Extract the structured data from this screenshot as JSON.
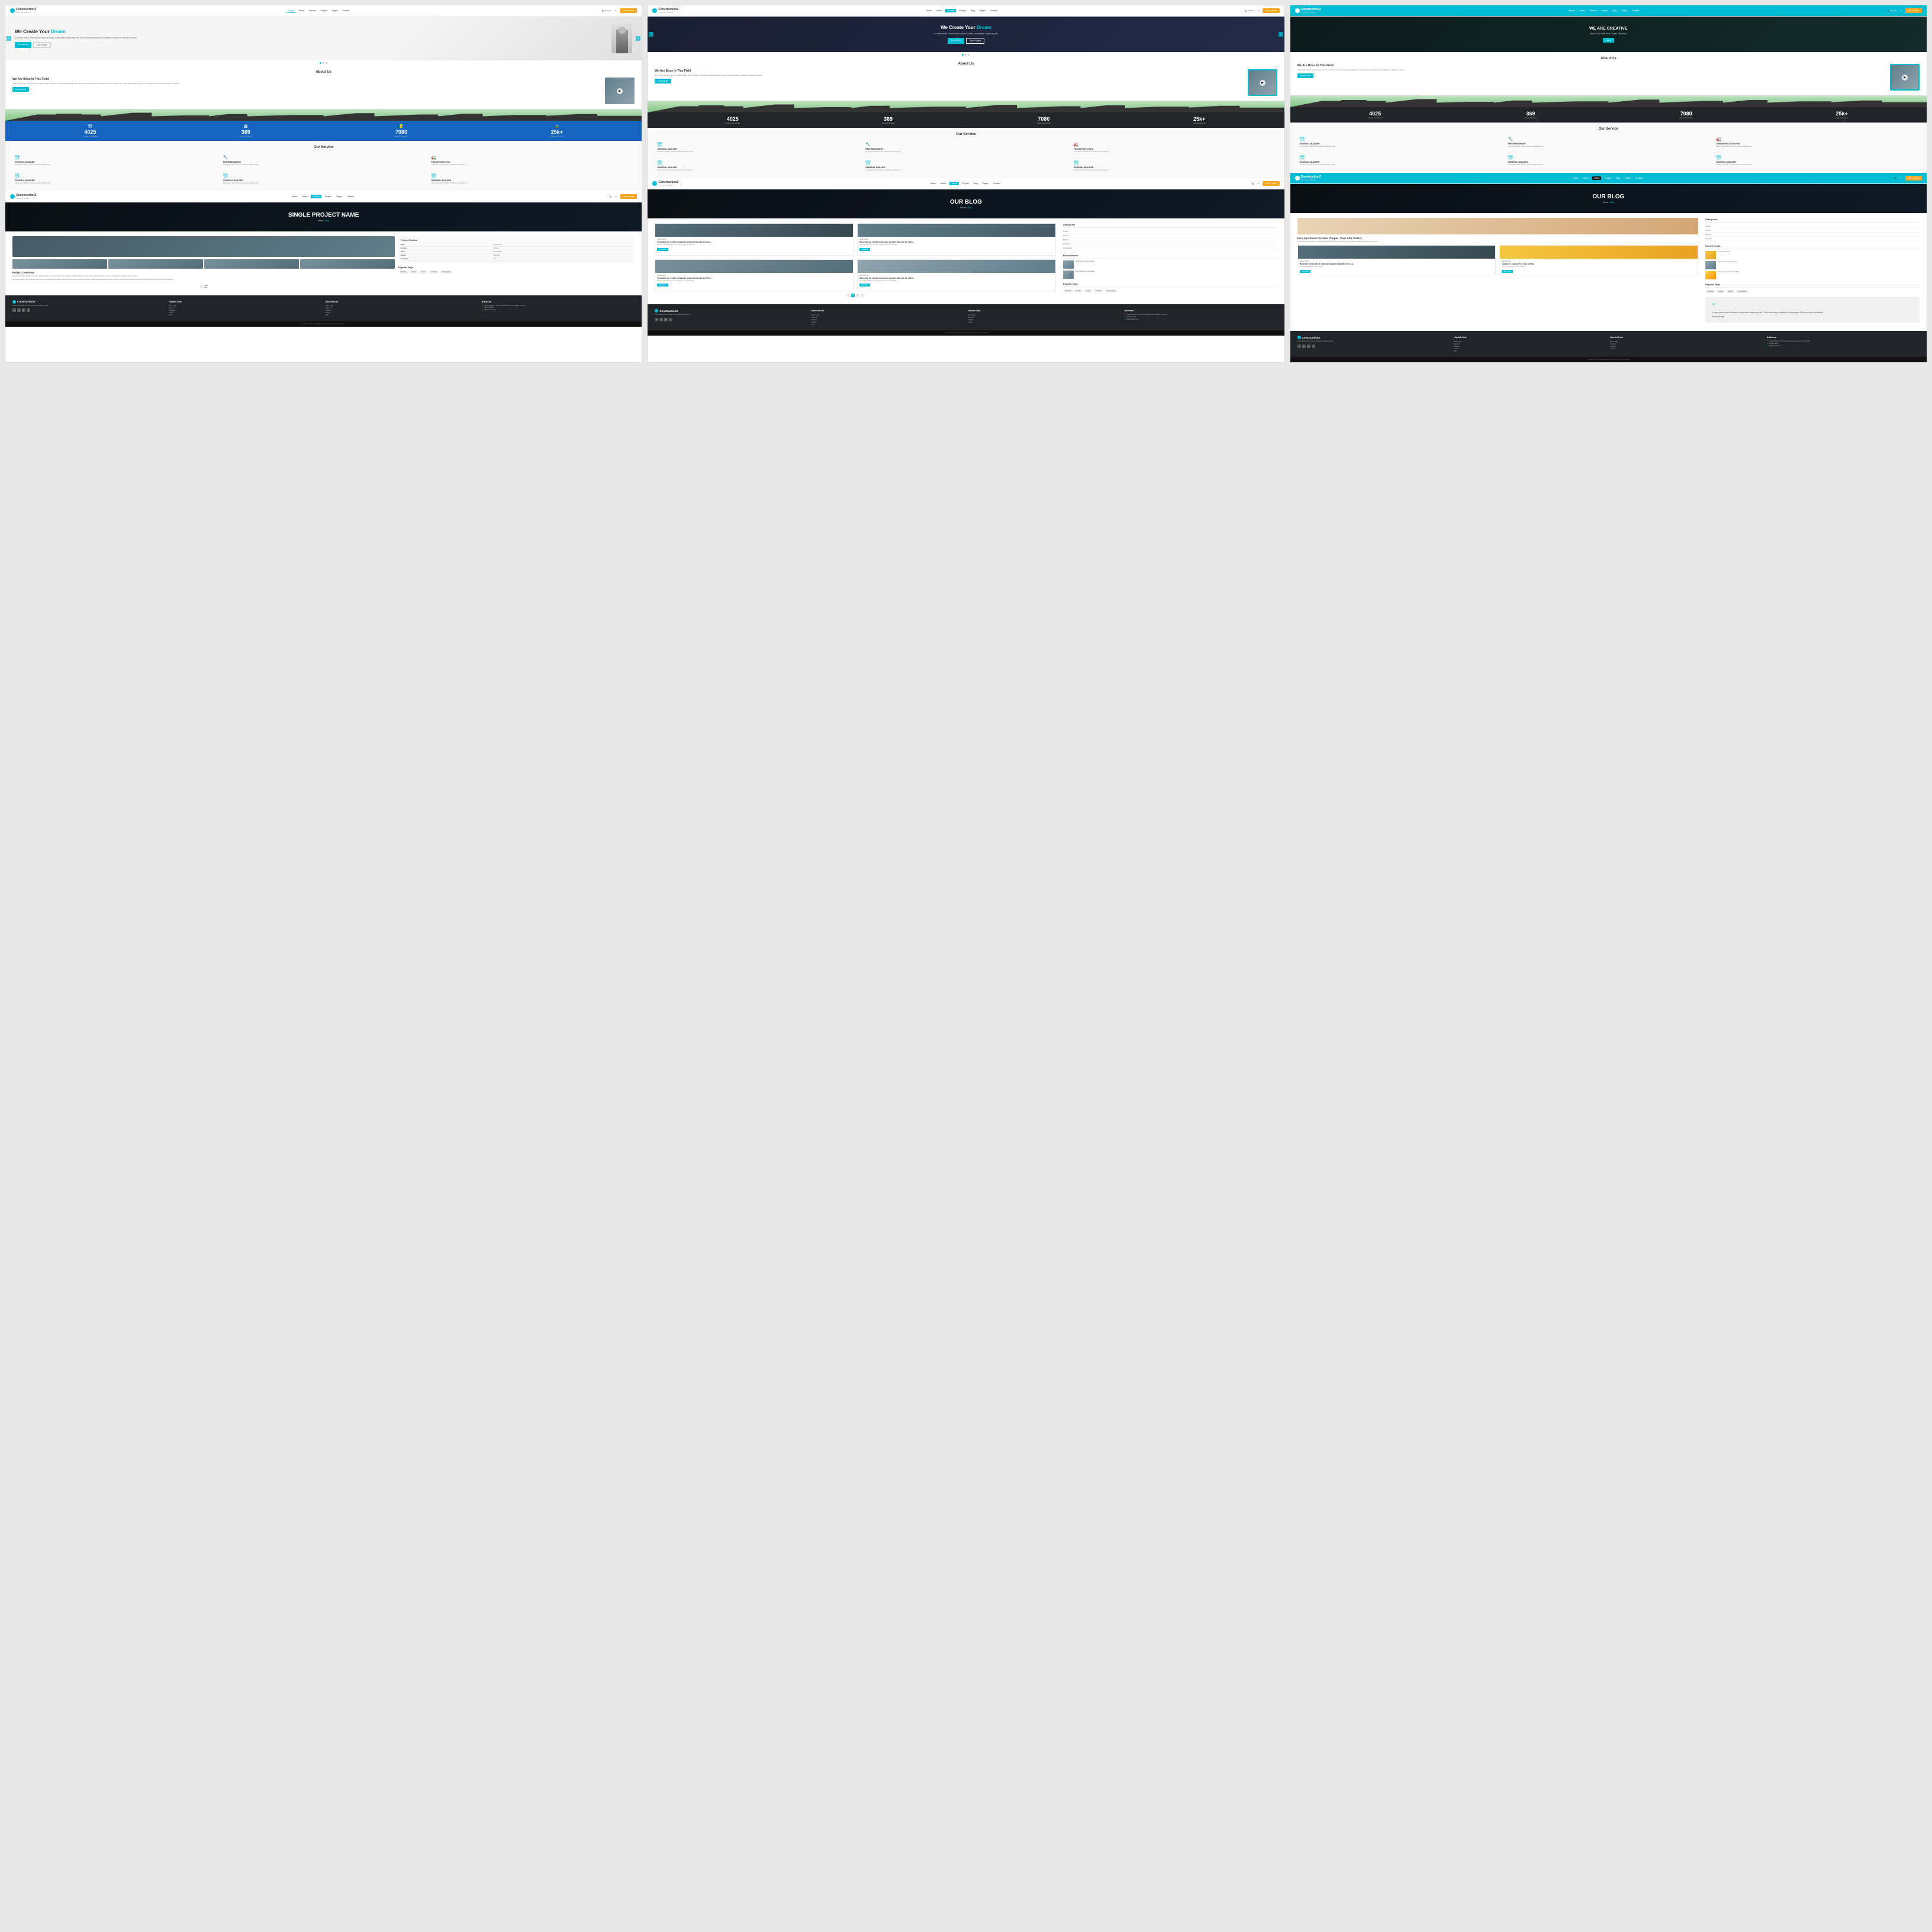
{
  "cards": [
    {
      "id": "card-1",
      "variant": "light-hero",
      "header": {
        "logo": "ConstructionZ",
        "tagline": "The King of Design",
        "nav": [
          "Home",
          "About",
          "Service",
          "Project",
          "Pages",
          "Contact"
        ],
        "active_nav": "Home",
        "hotline": "Hotline",
        "hotline_num": "444-444",
        "email": "Search",
        "cta": "Get a quote"
      },
      "hero": {
        "title": "We Create Your",
        "title_accent": "Dream",
        "subtitle": "our team amet Lorem ipsum dolor sit amet, consectetur adipiscing elit, sed do eiusmod tempor incididunt ut labore et dolore et labore.",
        "btn1": "Our Service",
        "btn2": "Our Project"
      },
      "about": {
        "section_title": "About Us",
        "sub_title": "We Are Boss In This Field",
        "body": "There was simply a dummy Lorem ipsum dolor sit amet, consectetur adipiscing elit, sed do eiusmod tempor incididunt ut labore et dolore et. There was simply a dummy Lorem ipsum dolor sit amet labore et dolore.",
        "btn": "Know More"
      },
      "stats": [
        {
          "num": "4025",
          "label": "Project Completed",
          "icon": "🏗"
        },
        {
          "num": "369",
          "label": "Running Project",
          "icon": "🏛"
        },
        {
          "num": "7080",
          "label": "Resource Person",
          "icon": "👷"
        },
        {
          "num": "25k+",
          "label": "Total Equipment",
          "icon": "🚜"
        }
      ],
      "stats_variant": "blue",
      "services": {
        "title": "Our Service",
        "items": [
          {
            "title": "GENERAL BUILDER",
            "desc": "Lorem ipsum dolor sit amet consectetur adipiscing elit sed do eiusmod."
          },
          {
            "title": "REFURBISHMENT",
            "desc": "Lorem ipsum dolor sit amet consectetur adipiscing elit sed do eiusmod."
          },
          {
            "title": "TRANSPORTATION",
            "desc": "Lorem ipsum dolor sit amet consectetur adipiscing elit sed do eiusmod."
          },
          {
            "title": "GENERAL BUILDER",
            "desc": "Lorem ipsum dolor sit amet consectetur adipiscing elit sed do eiusmod."
          },
          {
            "title": "GENERAL BUILDER",
            "desc": "Lorem ipsum dolor sit amet consectetur adipiscing elit sed do eiusmod."
          },
          {
            "title": "GENERAL BUILDER",
            "desc": "Lorem ipsum dolor sit amet consectetur adipiscing elit sed do eiusmod."
          }
        ]
      }
    },
    {
      "id": "card-2",
      "variant": "dark-hero",
      "header": {
        "logo": "ConstructionZ",
        "tagline": "The King of Design",
        "nav": [
          "Home",
          "About",
          "Service",
          "Project",
          "Blog",
          "Pages",
          "Contact"
        ],
        "active_nav": "Service",
        "hotline": "Hotline",
        "hotline_num": "444-444",
        "email": "Email",
        "cta": "Get a quote"
      },
      "hero": {
        "title": "We Create Your",
        "title_accent": "Dream",
        "subtitle": "our team amet Lorem ipsum dolor sit amet, consectetur adipiscing elit, sed do eiusmod tempor incididunt ut labore et dolore.",
        "btn1": "Our Service",
        "btn2": "Start Project"
      },
      "about": {
        "section_title": "About Us",
        "sub_title": "We Are Boss In This Field",
        "body": "There was simply a dummy Lorem ipsum dolor sit amet, consectetur adipiscing elit, sed do eiusmod tempor incididunt ut labore et dolore et. There was simply a dummy Lorem ipsum.",
        "btn": "Know More"
      },
      "stats": [
        {
          "num": "4025",
          "label": "Project Completed",
          "icon": "🏗"
        },
        {
          "num": "369",
          "label": "Running Project",
          "icon": "🏛"
        },
        {
          "num": "7080",
          "label": "Resource Person",
          "icon": "👷"
        },
        {
          "num": "25k+",
          "label": "Total Equipment",
          "icon": "🚜"
        }
      ],
      "stats_variant": "dark",
      "services": {
        "title": "Our Service",
        "items": [
          {
            "title": "GENERAL BUILDER",
            "desc": "Lorem ipsum dolor sit amet consectetur adipiscing elit sed do eiusmod."
          },
          {
            "title": "REFURBISHMENT",
            "desc": "Lorem ipsum dolor sit amet consectetur adipiscing elit sed do eiusmod."
          },
          {
            "title": "TRANSPORTATION",
            "desc": "Lorem ipsum dolor sit amet consectetur adipiscing elit sed do eiusmod."
          },
          {
            "title": "GENERAL BUILDER",
            "desc": "Lorem ipsum dolor sit amet consectetur adipiscing elit sed do eiusmod."
          },
          {
            "title": "GENERAL BUILDER",
            "desc": "Lorem ipsum dolor sit amet consectetur adipiscing elit sed do eiusmod."
          },
          {
            "title": "GENERAL BUILDER",
            "desc": "Lorem ipsum dolor sit amet consectetur adipiscing elit sed do eiusmod."
          }
        ]
      }
    },
    {
      "id": "card-3",
      "variant": "teal-hero",
      "header": {
        "logo": "ConstructionZ",
        "tagline": "The King of Design",
        "nav": [
          "Home",
          "About",
          "Service",
          "Project",
          "Blog",
          "Pages",
          "Contact"
        ],
        "active_nav": "Active",
        "hotline": "Hotline",
        "hotline_num": "444-444",
        "email": "Email",
        "cta": "Get a quote"
      },
      "hero": {
        "title": "WE ARE CREATIVE",
        "subtitle": "Help Us To Build Your Dream Tomorrow",
        "btn1": "Learn"
      },
      "about": {
        "section_title": "About Us",
        "sub_title": "We Are Boss In This Field",
        "body": "There was simply a dummy Lorem ipsum dolor sit amet, consectetur adipiscing elit, sed do eiusmod tempor incididunt ut labore et dolore. There was simply a dummy Lorem ipsum.",
        "btn": "Know More"
      },
      "stats": [
        {
          "num": "4025",
          "label": "Project Completed",
          "icon": "🏗"
        },
        {
          "num": "369",
          "label": "Running Project",
          "icon": "🏛"
        },
        {
          "num": "7080",
          "label": "Resource Person",
          "icon": "👷"
        },
        {
          "num": "25k+",
          "label": "Total Equipment",
          "icon": "🚜"
        }
      ],
      "stats_variant": "dark",
      "services": {
        "title": "Our Service",
        "items": [
          {
            "title": "GENERAL BUILDER",
            "desc": "Lorem ipsum dolor sit amet consectetur adipiscing elit sed do eiusmod."
          },
          {
            "title": "REFURBISHMENT",
            "desc": "Lorem ipsum dolor sit amet consectetur adipiscing elit sed do eiusmod."
          },
          {
            "title": "TRANSPORTATION FUN",
            "desc": "Lorem ipsum dolor sit amet consectetur adipiscing elit sed do eiusmod."
          },
          {
            "title": "GENERAL BUILDER",
            "desc": "Lorem ipsum dolor sit amet consectetur adipiscing elit sed do eiusmod."
          },
          {
            "title": "GENERAL BUILDER",
            "desc": "Lorem ipsum dolor sit amet consectetur adipiscing elit sed do eiusmod."
          },
          {
            "title": "GENERAL BUILDER",
            "desc": "Lorem ipsum dolor sit amet consectetur adipiscing elit sed do eiusmod."
          }
        ]
      }
    },
    {
      "id": "card-4",
      "variant": "single-project",
      "header": {
        "logo": "ConstructionZ",
        "tagline": "The King of Design",
        "nav": [
          "Home",
          "About",
          "Service",
          "Project",
          "Pages",
          "Contact"
        ],
        "active_nav": "Service",
        "hotline": "Hotline",
        "email": "Email",
        "cta": "Get a quote"
      },
      "page_hero": {
        "title": "SINGLE PROJECT NAME",
        "breadcrumb": "Home / Blog"
      },
      "project": {
        "details_title": "Project Detiles",
        "details": [
          {
            "label": "Name",
            "value": "Knight Tower"
          },
          {
            "label": "Location",
            "value": "Cullinan"
          },
          {
            "label": "Client",
            "value": "MN GROUP"
          },
          {
            "label": "Budget",
            "value": "$100,000"
          },
          {
            "label": "Completed",
            "value": "2017"
          }
        ],
        "tags_title": "Popular Tags",
        "tags": [
          "Booking",
          "Design",
          "Expert"
        ],
        "overview_title": "Project Overview",
        "overview_text": "Lorem ipsum dolor sit amet, consectetur adipiscing elit, sed do eiusmod tempor incididunt ut labore et dolore magna aliqua. Ut enim ad minim veniam, quis nostrud exercitation ullamco laboris nisi ut aliquip ex ea commodo consequat.\n\nSed ut perspiciatis unde omnis iste natus error sit voluptatem accusantium doloremque laudantium, totam rem aperiam, eaque ipsa quae ab illo inventore veritatis et quasi architecto beatae vitae dicta sunt explicabo."
      }
    },
    {
      "id": "card-5",
      "variant": "blog-light",
      "header": {
        "logo": "ConstructionZ",
        "tagline": "The King of Design",
        "nav": [
          "Home",
          "About",
          "Service",
          "Project",
          "Blog",
          "Pages",
          "Contact"
        ],
        "active_nav": "Active",
        "hotline": "Hotline",
        "email": "Email",
        "cta": "Get a quote"
      },
      "page_hero": {
        "title": "OUR BLOG",
        "breadcrumb": "Home / Blog"
      },
      "blog": {
        "posts": [
          {
            "author": "Author Admin",
            "title": "Recently we create a massive project that will be 0714...",
            "desc": "This is a description of our company we do a lot of things. This is a description of our company labore et dolore.",
            "btn": "Read More",
            "date": "12 Jan"
          },
          {
            "author": "Author Admin",
            "title": "Recently we create a massive project that will be 0714...",
            "desc": "This is a description of our company we do a lot of things. This is a description of our company labore et dolore.",
            "btn": "Read More",
            "date": "15 Jan"
          },
          {
            "author": "Author Admin",
            "title": "Recently we create a massive project that will be 0714...",
            "desc": "This is a description of our company we do a lot of things. This is a description of our company labore et dolore.",
            "btn": "Read More",
            "date": "18 Jan"
          },
          {
            "author": "Author Admin",
            "title": "Recently we create a massive project that will be 0714...",
            "desc": "This is a description of our company we do a lot of things. This is a description of our company labore et dolore.",
            "btn": "Read More",
            "date": "20 Jan"
          }
        ],
        "sidebar": {
          "categories_title": "Categories",
          "categories": [
            "Travel",
            "Interior",
            "Exterior",
            "Property",
            "Technology"
          ],
          "recent_title": "Recent Posts",
          "recent": [
            "New Projects on Your Budget",
            "New Projects on Your Budget"
          ],
          "tags_title": "Popular Tags",
          "tags": [
            "Booking",
            "Design",
            "Expert",
            "Architect",
            "Photography"
          ]
        }
      }
    },
    {
      "id": "card-6",
      "variant": "blog-dark",
      "header": {
        "logo": "ConstructionZ",
        "tagline": "The King of Design",
        "nav": [
          "Home",
          "About",
          "Service",
          "Project",
          "Blog",
          "Pages",
          "Contact"
        ],
        "active_nav": "Active",
        "hotline": "Hotline",
        "email": "Email",
        "cta": "Get a quote"
      },
      "page_hero": {
        "title": "OUR BLOG",
        "breadcrumb": "Home / Blog"
      },
      "blog": {
        "featured_post": {
          "title": "Nice Apartment For New Couple - Post with Gallery",
          "desc": "Lorem ipsum dolor sit amet, consectetur adipiscing elit, sed do eiusmod tempor incididunt ut labore et dolore magna aliqua. Ut enim ad minim veniam."
        },
        "posts": [
          {
            "author": "Author Admin",
            "title": "Recently we create a massive project that will be 0714...",
            "desc": "This is a description of our company.",
            "btn": "Read More",
            "date": "12 Jan"
          },
          {
            "author": "Author Admin",
            "title": "Recently we create a massive project that will be 0714...",
            "desc": "This is a description of our company.",
            "btn": "Read More",
            "date": "15 Jan"
          }
        ],
        "sidebar": {
          "categories_title": "Categories",
          "categories": [
            "Travel",
            "Interior",
            "Exterior",
            "Property"
          ],
          "recent_title": "Recent Posts",
          "recent": [
            "New Projects on Your Budget",
            "New Projects on Your Budget"
          ],
          "tags_title": "Popular Tags",
          "tags": [
            "Booking",
            "Design",
            "Expert",
            "Photography"
          ],
          "quote": "Lorem ipsum dolor sit amet, consectetur adipiscing elit. There are many variations of passages of Lorem Ipsum available.",
          "quote_author": "Said And Wity"
        }
      }
    }
  ],
  "footer": {
    "logo": "ConstructionZ",
    "tagline": "The King of Design",
    "about_text": "Lorem ipsum dolor sit amet, consectetur adipiscing elit, sed do eiusmod tempor incididunt ut labore et dolore.",
    "useful_link_title": "Useful Link",
    "useful_links": [
      "Home Page",
      "About Us",
      "Category",
      "Service",
      "FAQ",
      "CMS"
    ],
    "useful_link2_title": "Useful Link",
    "useful_links2": [
      "Home Page",
      "About Us",
      "Category",
      "Service",
      "FAQ",
      "CMS"
    ],
    "address_title": "Address",
    "address_line1": "United Kingdom, 343 Pennsylvania Avenue Upload, CA 91764",
    "phone": "444-452-1931",
    "email": "info@yoursite.com",
    "copyright": "© 2019 YourSite. All Rights Reserved & Designed By ThemeSine"
  },
  "icons": {
    "building": "🏗",
    "crane": "🏛",
    "worker": "👷",
    "equipment": "🚜",
    "wrench": "🔧",
    "truck": "🚛",
    "play": "▶",
    "arrow_left": "‹",
    "arrow_right": "›",
    "phone": "📞",
    "mail": "✉",
    "location": "📍",
    "chevron_right": "›",
    "facebook": "f",
    "twitter": "t",
    "linkedin": "in",
    "youtube": "y"
  }
}
